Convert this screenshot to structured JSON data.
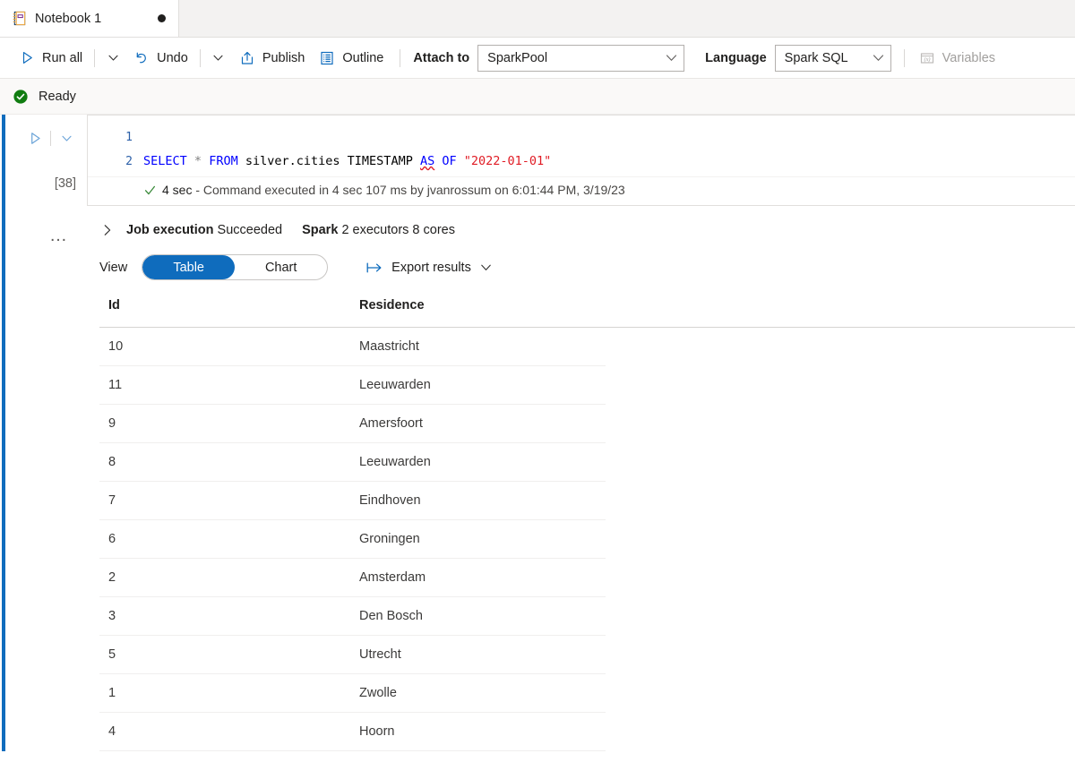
{
  "tab": {
    "label": "Notebook 1",
    "icon": "notebook-icon",
    "dirty_indicator": "unsaved-dot"
  },
  "toolbar": {
    "run_all": "Run all",
    "run_all_icon": "play-icon",
    "run_all_caret": "chevron-down-icon",
    "undo": "Undo",
    "undo_icon": "undo-arrow-icon",
    "undo_caret": "chevron-down-icon",
    "publish": "Publish",
    "publish_icon": "publish-upload-icon",
    "outline": "Outline",
    "outline_icon": "outline-list-icon",
    "attach_to_label": "Attach to",
    "attach_to_value": "SparkPool",
    "language_label": "Language",
    "language_value": "Spark SQL",
    "variables": "Variables",
    "variables_icon": "variables-xbox-icon",
    "variables_disabled": true
  },
  "status": {
    "text": "Ready",
    "icon": "success-check-circle-icon",
    "color": "#107c10"
  },
  "cell": {
    "run_icon": "play-icon",
    "caret_icon": "chevron-down-icon",
    "execution_count": "[38]",
    "more_menu": "…",
    "line_numbers": [
      "1",
      "2"
    ],
    "code_tokens": [
      {
        "text": "SELECT",
        "kind": "keyword"
      },
      {
        "text": " ",
        "kind": "plain"
      },
      {
        "text": "*",
        "kind": "operator"
      },
      {
        "text": " ",
        "kind": "plain"
      },
      {
        "text": "FROM",
        "kind": "keyword"
      },
      {
        "text": " ",
        "kind": "plain"
      },
      {
        "text": "silver.cities",
        "kind": "identifier"
      },
      {
        "text": " ",
        "kind": "plain"
      },
      {
        "text": "TIMESTAMP",
        "kind": "identifier"
      },
      {
        "text": " ",
        "kind": "plain"
      },
      {
        "text": "AS",
        "kind": "keyword-error"
      },
      {
        "text": " ",
        "kind": "plain"
      },
      {
        "text": "OF",
        "kind": "keyword"
      },
      {
        "text": " ",
        "kind": "plain"
      },
      {
        "text": "\"2022-01-01\"",
        "kind": "string"
      }
    ],
    "code_plain": "SELECT * FROM silver.cities TIMESTAMP AS OF \"2022-01-01\"",
    "exec_check_icon": "check-icon",
    "exec_duration": "4 sec",
    "exec_detail": " - Command executed in 4 sec 107 ms by jvanrossum on 6:01:44 PM, 3/19/23"
  },
  "job": {
    "chevron_icon": "chevron-right-icon",
    "title": "Job execution",
    "status": "Succeeded",
    "engine": "Spark",
    "engine_detail": "2 executors 8 cores"
  },
  "results_toolbar": {
    "view_label": "View",
    "tab_table": "Table",
    "tab_chart": "Chart",
    "active_tab": "Table",
    "export_label": "Export results",
    "export_icon": "export-arrow-icon",
    "export_caret": "chevron-down-icon"
  },
  "results_table": {
    "columns": [
      "Id",
      "Residence"
    ],
    "rows": [
      [
        "10",
        "Maastricht"
      ],
      [
        "11",
        "Leeuwarden"
      ],
      [
        "9",
        "Amersfoort"
      ],
      [
        "8",
        "Leeuwarden"
      ],
      [
        "7",
        "Eindhoven"
      ],
      [
        "6",
        "Groningen"
      ],
      [
        "2",
        "Amsterdam"
      ],
      [
        "3",
        "Den Bosch"
      ],
      [
        "5",
        "Utrecht"
      ],
      [
        "1",
        "Zwolle"
      ],
      [
        "4",
        "Hoorn"
      ]
    ]
  },
  "colors": {
    "accent": "#0f6cbd",
    "success": "#107c10",
    "keyword": "#0000ff",
    "string": "#e01b24"
  }
}
